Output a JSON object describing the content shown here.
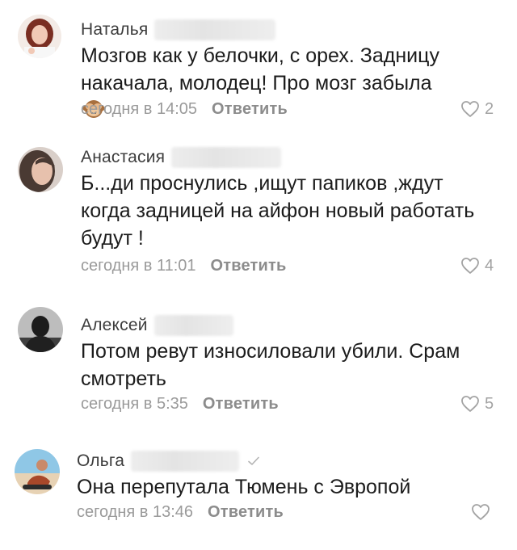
{
  "comments": [
    {
      "author": "Наталья",
      "lines": [
        "Мозгов как у белочки, с орех. Задницу",
        "накачала, молодец! Про мозг забыла"
      ],
      "emoji": "see-no-evil-monkey",
      "time": "сегодня в 14:05",
      "reply": "Ответить",
      "likes": "2"
    },
    {
      "author": "Анастасия",
      "lines": [
        "Б...ди проснулись ,ищут папиков ,ждут",
        "когда задницей на айфон новый работать",
        "будут !"
      ],
      "time": "сегодня в 11:01",
      "reply": "Ответить",
      "likes": "4"
    },
    {
      "author": "Алексей",
      "lines": [
        "Потом ревут износиловали убили. Срам",
        "смотреть"
      ],
      "time": "сегодня в 5:35",
      "reply": "Ответить",
      "likes": "5"
    },
    {
      "author": "Ольга",
      "lines": [
        "Она перепутала Тюмень с Эвропой"
      ],
      "time": "сегодня в 13:46",
      "reply": "Ответить",
      "likes": ""
    }
  ],
  "icons": {
    "like": "heart-outline-icon",
    "verified": "checkmark-icon"
  },
  "colors": {
    "text": "#1c1c1c",
    "author": "#3c3c3c",
    "meta": "#9a9a9a",
    "heart": "#a3a3a3"
  }
}
